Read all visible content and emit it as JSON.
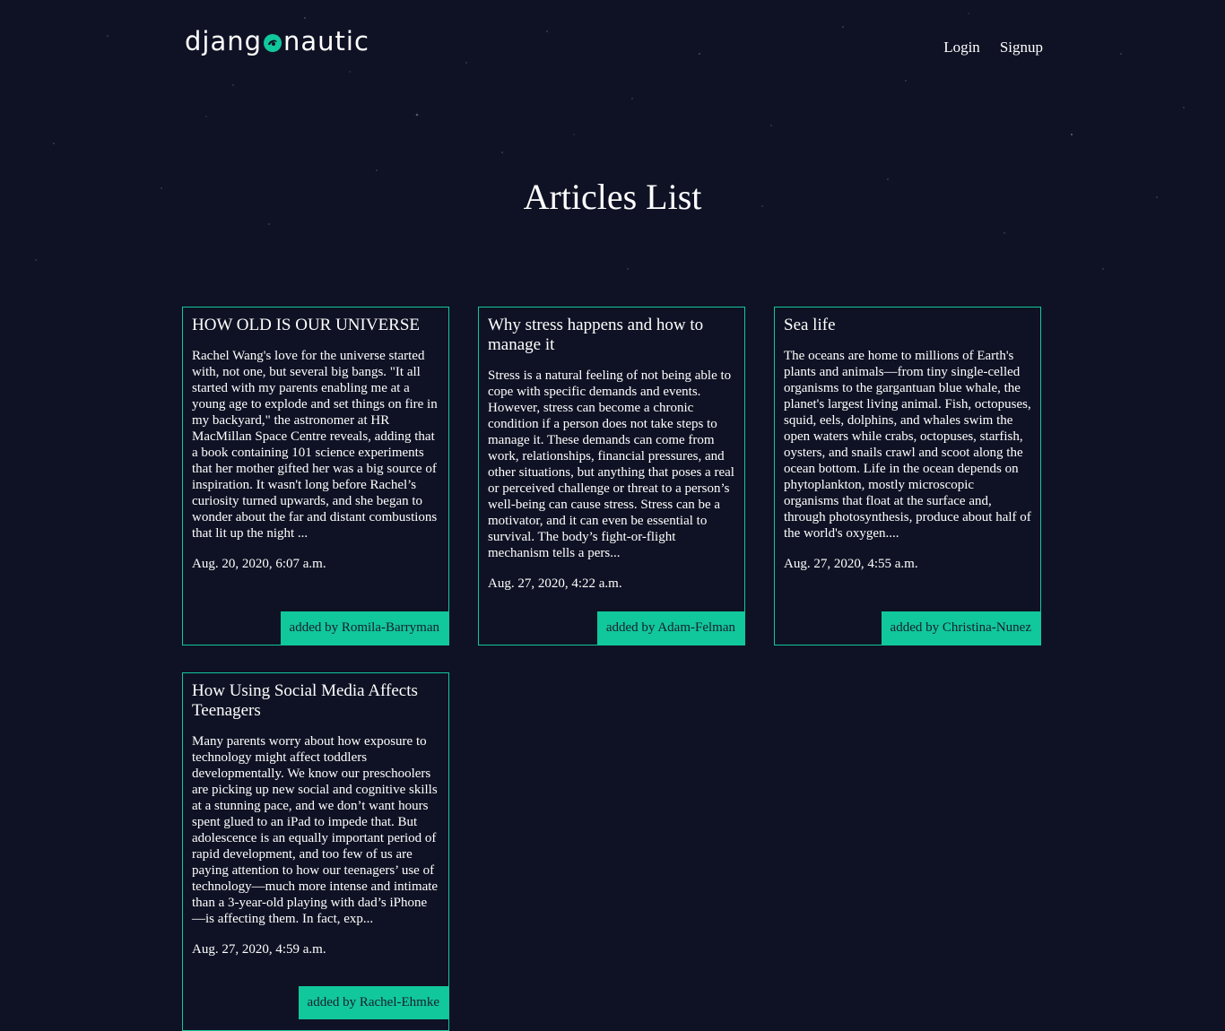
{
  "header": {
    "logo": {
      "text_before": "djang",
      "text_after": "nautic",
      "accent_color": "#11c79c"
    },
    "nav": {
      "login_label": "Login",
      "signup_label": "Signup"
    }
  },
  "page": {
    "title": "Articles List",
    "background_color": "#0f1224",
    "card_border_color": "#11c79c"
  },
  "articles": [
    {
      "title": "HOW OLD IS OUR UNIVERSE",
      "snippet": "Rachel Wang's love for the universe started with, not one, but several big bangs. \"It all started with my parents enabling me at a young age to explode and set things on fire in my backyard,\" the astronomer at HR MacMillan Space Centre reveals, adding that a book containing 101 science experiments that her mother gifted her was a big source of inspiration. It wasn't long before Rachel’s curiosity turned upwards, and she began to wonder about the far and distant combustions that lit up the night ...",
      "date": "Aug. 20, 2020, 6:07 a.m.",
      "author_label": "added by Romila-Barryman"
    },
    {
      "title": "Why stress happens and how to manage it",
      "snippet": "Stress is a natural feeling of not being able to cope with specific demands and events. However, stress can become a chronic condition if a person does not take steps to manage it. These demands can come from work, relationships, financial pressures, and other situations, but anything that poses a real or perceived challenge or threat to a person’s well-being can cause stress. Stress can be a motivator, and it can even be essential to survival. The body’s fight-or-flight mechanism tells a pers...",
      "date": "Aug. 27, 2020, 4:22 a.m.",
      "author_label": "added by Adam-Felman"
    },
    {
      "title": "Sea life",
      "snippet": "The oceans are home to millions of Earth's plants and animals—from tiny single-celled organisms to the gargantuan blue whale, the planet's largest living animal. Fish, octopuses, squid, eels, dolphins, and whales swim the open waters while crabs, octopuses, starfish, oysters, and snails crawl and scoot along the ocean bottom. Life in the ocean depends on phytoplankton, mostly microscopic organisms that float at the surface and, through photosynthesis, produce about half of the world's oxygen....",
      "date": "Aug. 27, 2020, 4:55 a.m.",
      "author_label": "added by Christina-Nunez"
    },
    {
      "title": "How Using Social Media Affects Teenagers",
      "snippet": "Many parents worry about how exposure to technology might affect toddlers developmentally. We know our preschoolers are picking up new social and cognitive skills at a stunning pace, and we don’t want hours spent glued to an iPad to impede that. But adolescence is an equally important period of rapid development, and too few of us are paying attention to how our teenagers’ use of technology—much more intense and intimate than a 3-year-old playing with dad’s iPhone—is affecting them. In fact, exp...",
      "date": "Aug. 27, 2020, 4:59 a.m.",
      "author_label": "added by Rachel-Ehmke"
    }
  ]
}
